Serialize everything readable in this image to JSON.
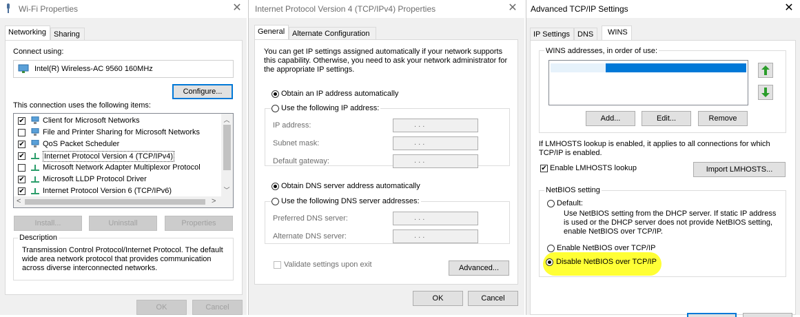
{
  "colors": {
    "selection": "#0078d7",
    "highlight": "#ffff2a",
    "arrow_green": "#2a9d2a",
    "network_icon": "#2a7fbf"
  },
  "wifi": {
    "title": "Wi-Fi Properties",
    "tabs": [
      "Networking",
      "Sharing"
    ],
    "connect_using_label": "Connect using:",
    "adapter": "Intel(R) Wireless-AC 9560 160MHz",
    "configure_btn": "Configure...",
    "items_label": "This connection uses the following items:",
    "items": [
      {
        "label": "Client for Microsoft Networks",
        "checked": true,
        "icon": "network-client-icon"
      },
      {
        "label": "File and Printer Sharing for Microsoft Networks",
        "checked": false,
        "icon": "file-sharing-icon"
      },
      {
        "label": "QoS Packet Scheduler",
        "checked": true,
        "icon": "qos-icon"
      },
      {
        "label": "Internet Protocol Version 4 (TCP/IPv4)",
        "checked": true,
        "icon": "protocol-icon"
      },
      {
        "label": "Microsoft Network Adapter Multiplexor Protocol",
        "checked": false,
        "icon": "protocol-icon"
      },
      {
        "label": "Microsoft LLDP Protocol Driver",
        "checked": true,
        "icon": "protocol-icon"
      },
      {
        "label": "Internet Protocol Version 6 (TCP/IPv6)",
        "checked": true,
        "icon": "protocol-icon"
      }
    ],
    "install_btn": "Install...",
    "uninstall_btn": "Uninstall",
    "properties_btn": "Properties",
    "description_label": "Description",
    "description_text": "Transmission Control Protocol/Internet Protocol. The default wide area network protocol that provides communication across diverse interconnected networks.",
    "ok_btn": "OK",
    "cancel_btn": "Cancel"
  },
  "ipv4": {
    "title": "Internet Protocol Version 4 (TCP/IPv4) Properties",
    "tabs": [
      "General",
      "Alternate Configuration"
    ],
    "info_text": "You can get IP settings assigned automatically if your network supports this capability. Otherwise, you need to ask your network administrator for the appropriate IP settings.",
    "obtain_ip": "Obtain an IP address automatically",
    "use_ip": "Use the following IP address:",
    "ip_address_label": "IP address:",
    "subnet_label": "Subnet mask:",
    "gateway_label": "Default gateway:",
    "obtain_dns": "Obtain DNS server address automatically",
    "use_dns": "Use the following DNS server addresses:",
    "preferred_dns_label": "Preferred DNS server:",
    "alternate_dns_label": "Alternate DNS server:",
    "ip_dots": ".       .       .",
    "validate_label": "Validate settings upon exit",
    "advanced_btn": "Advanced...",
    "ok_btn": "OK",
    "cancel_btn": "Cancel"
  },
  "advanced": {
    "title": "Advanced TCP/IP Settings",
    "tabs": [
      "IP Settings",
      "DNS",
      "WINS"
    ],
    "wins_group_label": "WINS addresses, in order of use:",
    "add_btn": "Add...",
    "edit_btn": "Edit...",
    "remove_btn": "Remove",
    "lmhosts_info": "If LMHOSTS lookup is enabled, it applies to all connections for which TCP/IP is enabled.",
    "enable_lmhosts": "Enable LMHOSTS lookup",
    "import_lmhosts_btn": "Import LMHOSTS...",
    "netbios_group_label": "NetBIOS setting",
    "default_label": "Default:",
    "default_desc": "Use NetBIOS setting from the DHCP server. If static IP address is used or the DHCP server does not provide NetBIOS setting, enable NetBIOS over TCP/IP.",
    "enable_netbios": "Enable NetBIOS over TCP/IP",
    "disable_netbios": "Disable NetBIOS over TCP/IP"
  }
}
